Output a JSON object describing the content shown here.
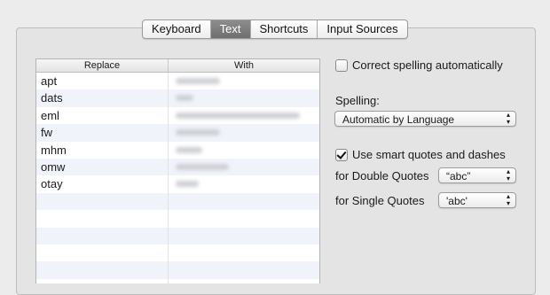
{
  "tabs": [
    {
      "label": "Keyboard",
      "selected": false
    },
    {
      "label": "Text",
      "selected": true
    },
    {
      "label": "Shortcuts",
      "selected": false
    },
    {
      "label": "Input Sources",
      "selected": false
    }
  ],
  "table": {
    "columns": [
      "Replace",
      "With"
    ],
    "rows": [
      {
        "replace": "apt",
        "with_redacted": true
      },
      {
        "replace": "dats",
        "with_redacted": true
      },
      {
        "replace": "eml",
        "with_redacted": true
      },
      {
        "replace": "fw",
        "with_redacted": true
      },
      {
        "replace": "mhm",
        "with_redacted": true
      },
      {
        "replace": "omw",
        "with_redacted": true
      },
      {
        "replace": "otay",
        "with_redacted": true
      }
    ]
  },
  "options": {
    "correct_spelling": {
      "label": "Correct spelling automatically",
      "checked": false
    },
    "spelling_label": "Spelling:",
    "spelling_value": "Automatic by Language",
    "smart_quotes": {
      "label": "Use smart quotes and dashes",
      "checked": true
    },
    "double_quotes_label": "for Double Quotes",
    "double_quotes_value": "“abc”",
    "single_quotes_label": "for Single Quotes",
    "single_quotes_value": "'abc'"
  },
  "colors": {
    "selected_tab": "#7d7d7d",
    "alt_row": "#f0f4fa"
  }
}
